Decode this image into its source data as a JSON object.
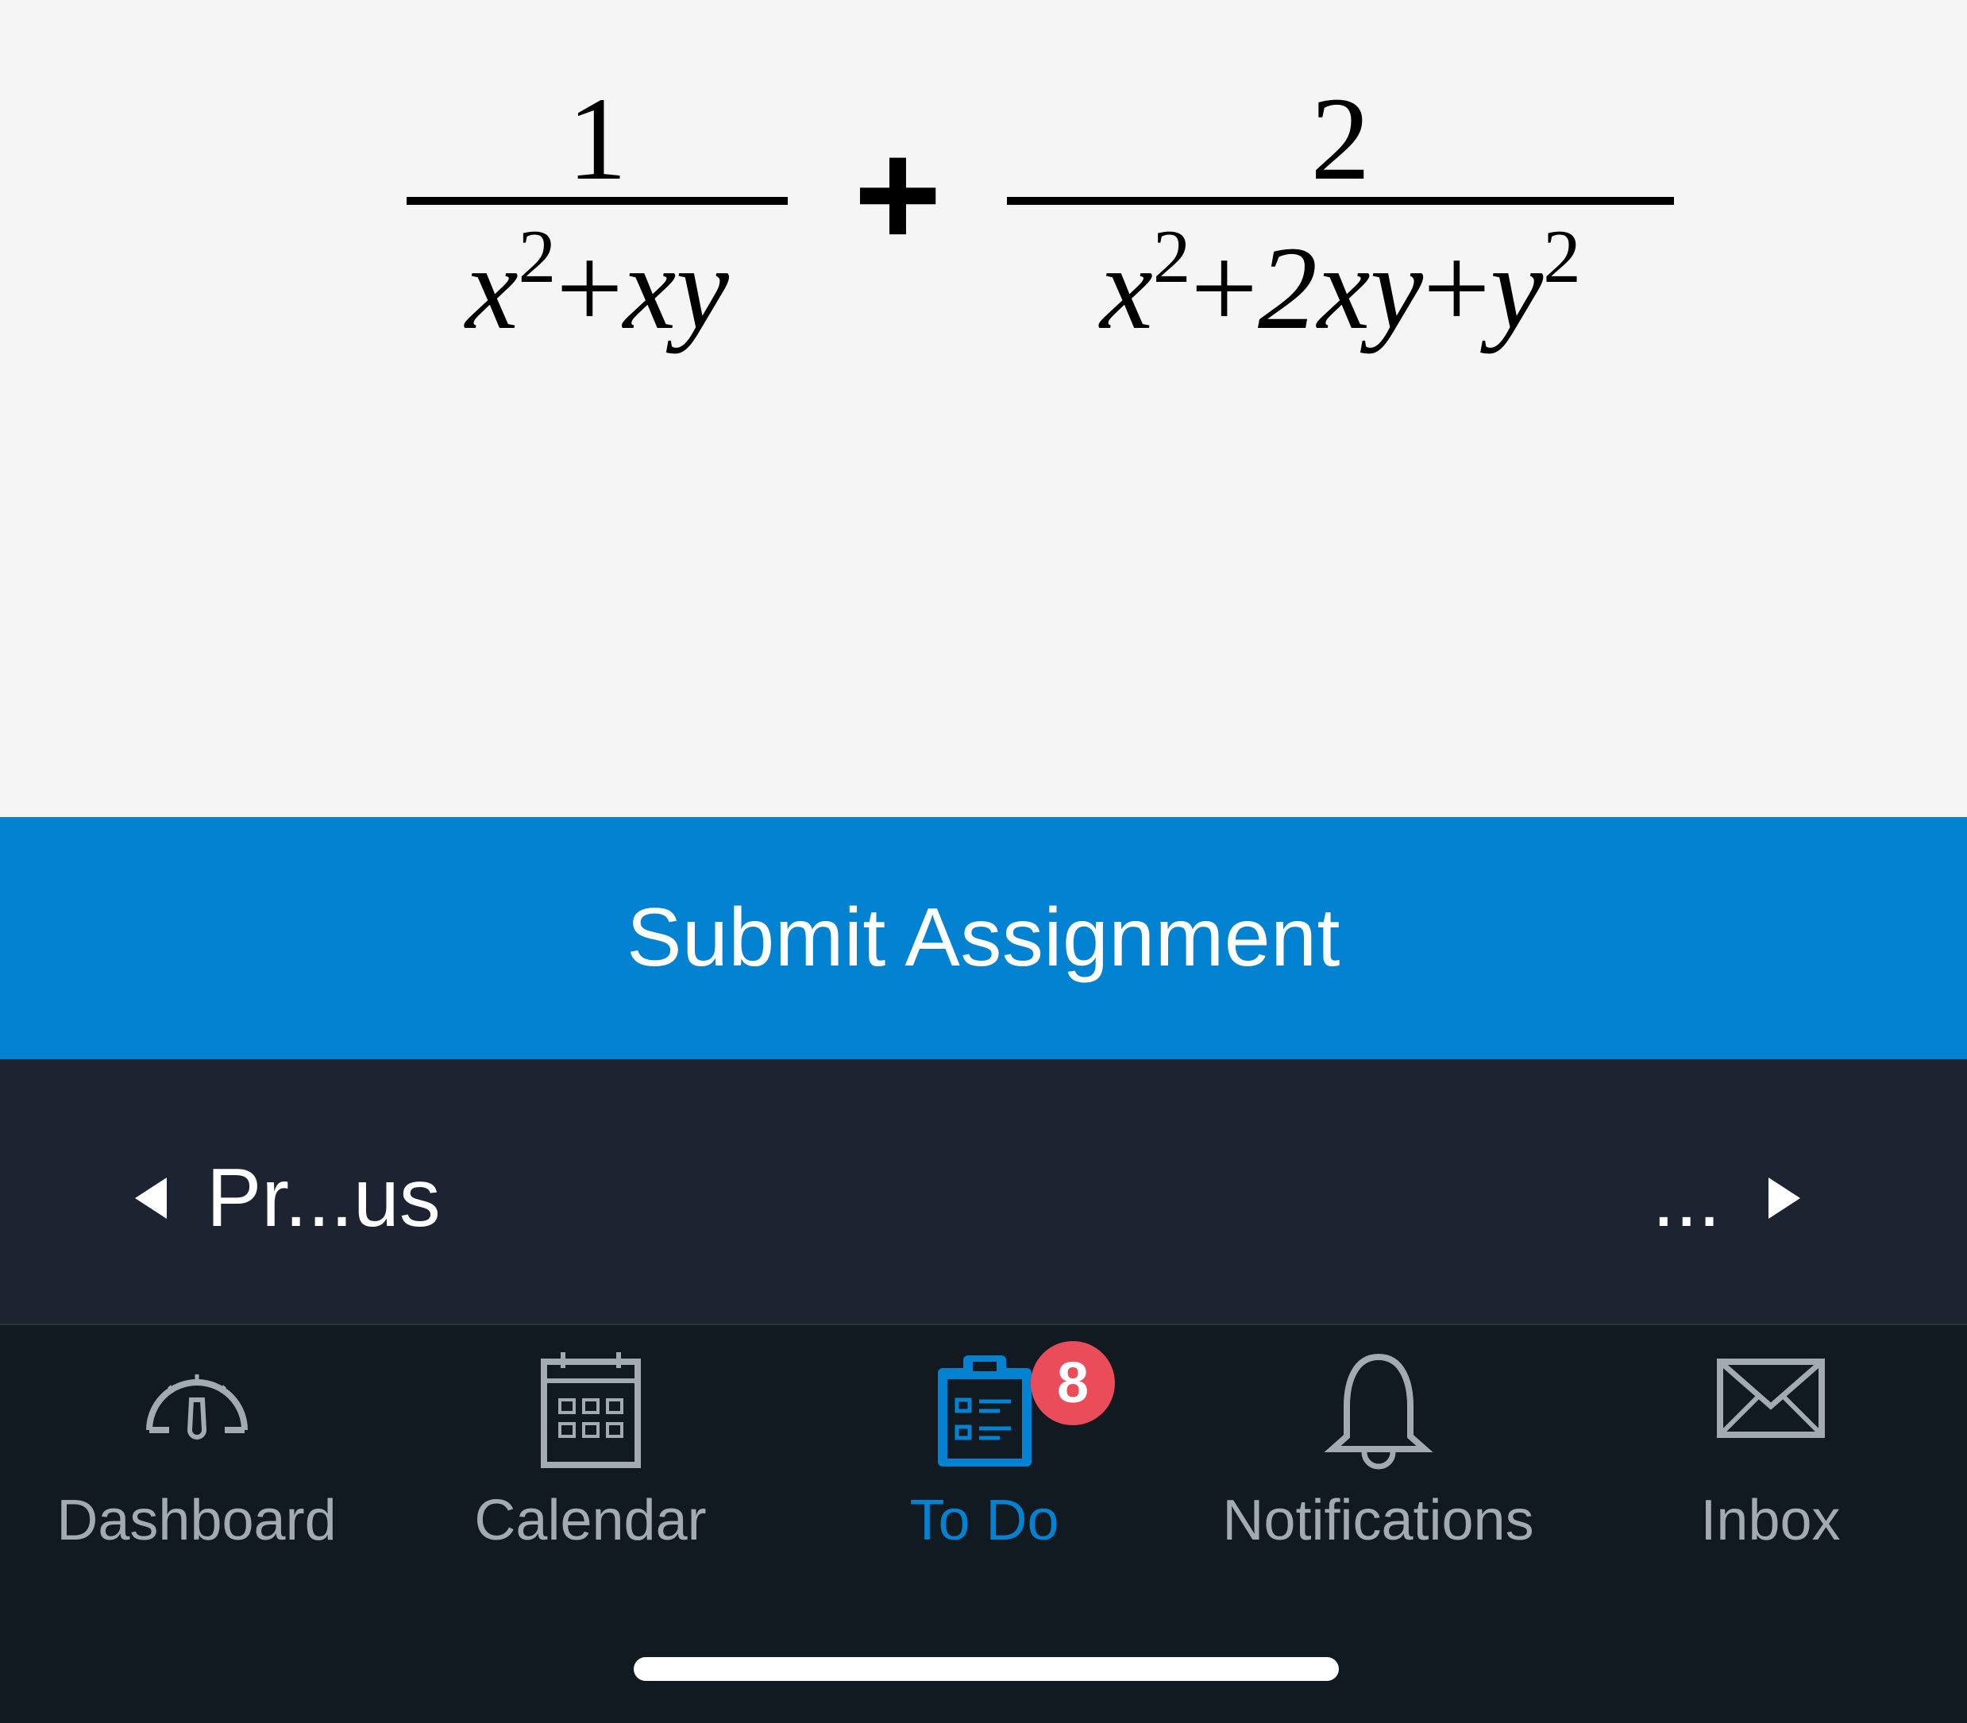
{
  "expression": {
    "term1": {
      "numerator": "1",
      "den_a": "x",
      "den_a_exp": "2",
      "den_op1": "+",
      "den_b": "xy"
    },
    "operator": "+",
    "term2": {
      "numerator": "2",
      "den_a": "x",
      "den_a_exp": "2",
      "den_op1": "+",
      "den_b": "2xy",
      "den_op2": "+",
      "den_c": "y",
      "den_c_exp": "2"
    }
  },
  "submit": {
    "label": "Submit Assignment",
    "color": "#0482d2"
  },
  "pager": {
    "previous_label": "Pr...us",
    "next_label": "..."
  },
  "tabbar": {
    "tabs": [
      {
        "label": "Dashboard",
        "icon": "dashboard-gauge-icon"
      },
      {
        "label": "Calendar",
        "icon": "calendar-icon"
      },
      {
        "label": "To Do",
        "icon": "clipboard-checklist-icon",
        "active": true,
        "badge": "8"
      },
      {
        "label": "Notifications",
        "icon": "bell-icon"
      },
      {
        "label": "Inbox",
        "icon": "envelope-icon"
      }
    ],
    "active_color": "#0482d2",
    "badge_color": "#ea4c5a"
  }
}
